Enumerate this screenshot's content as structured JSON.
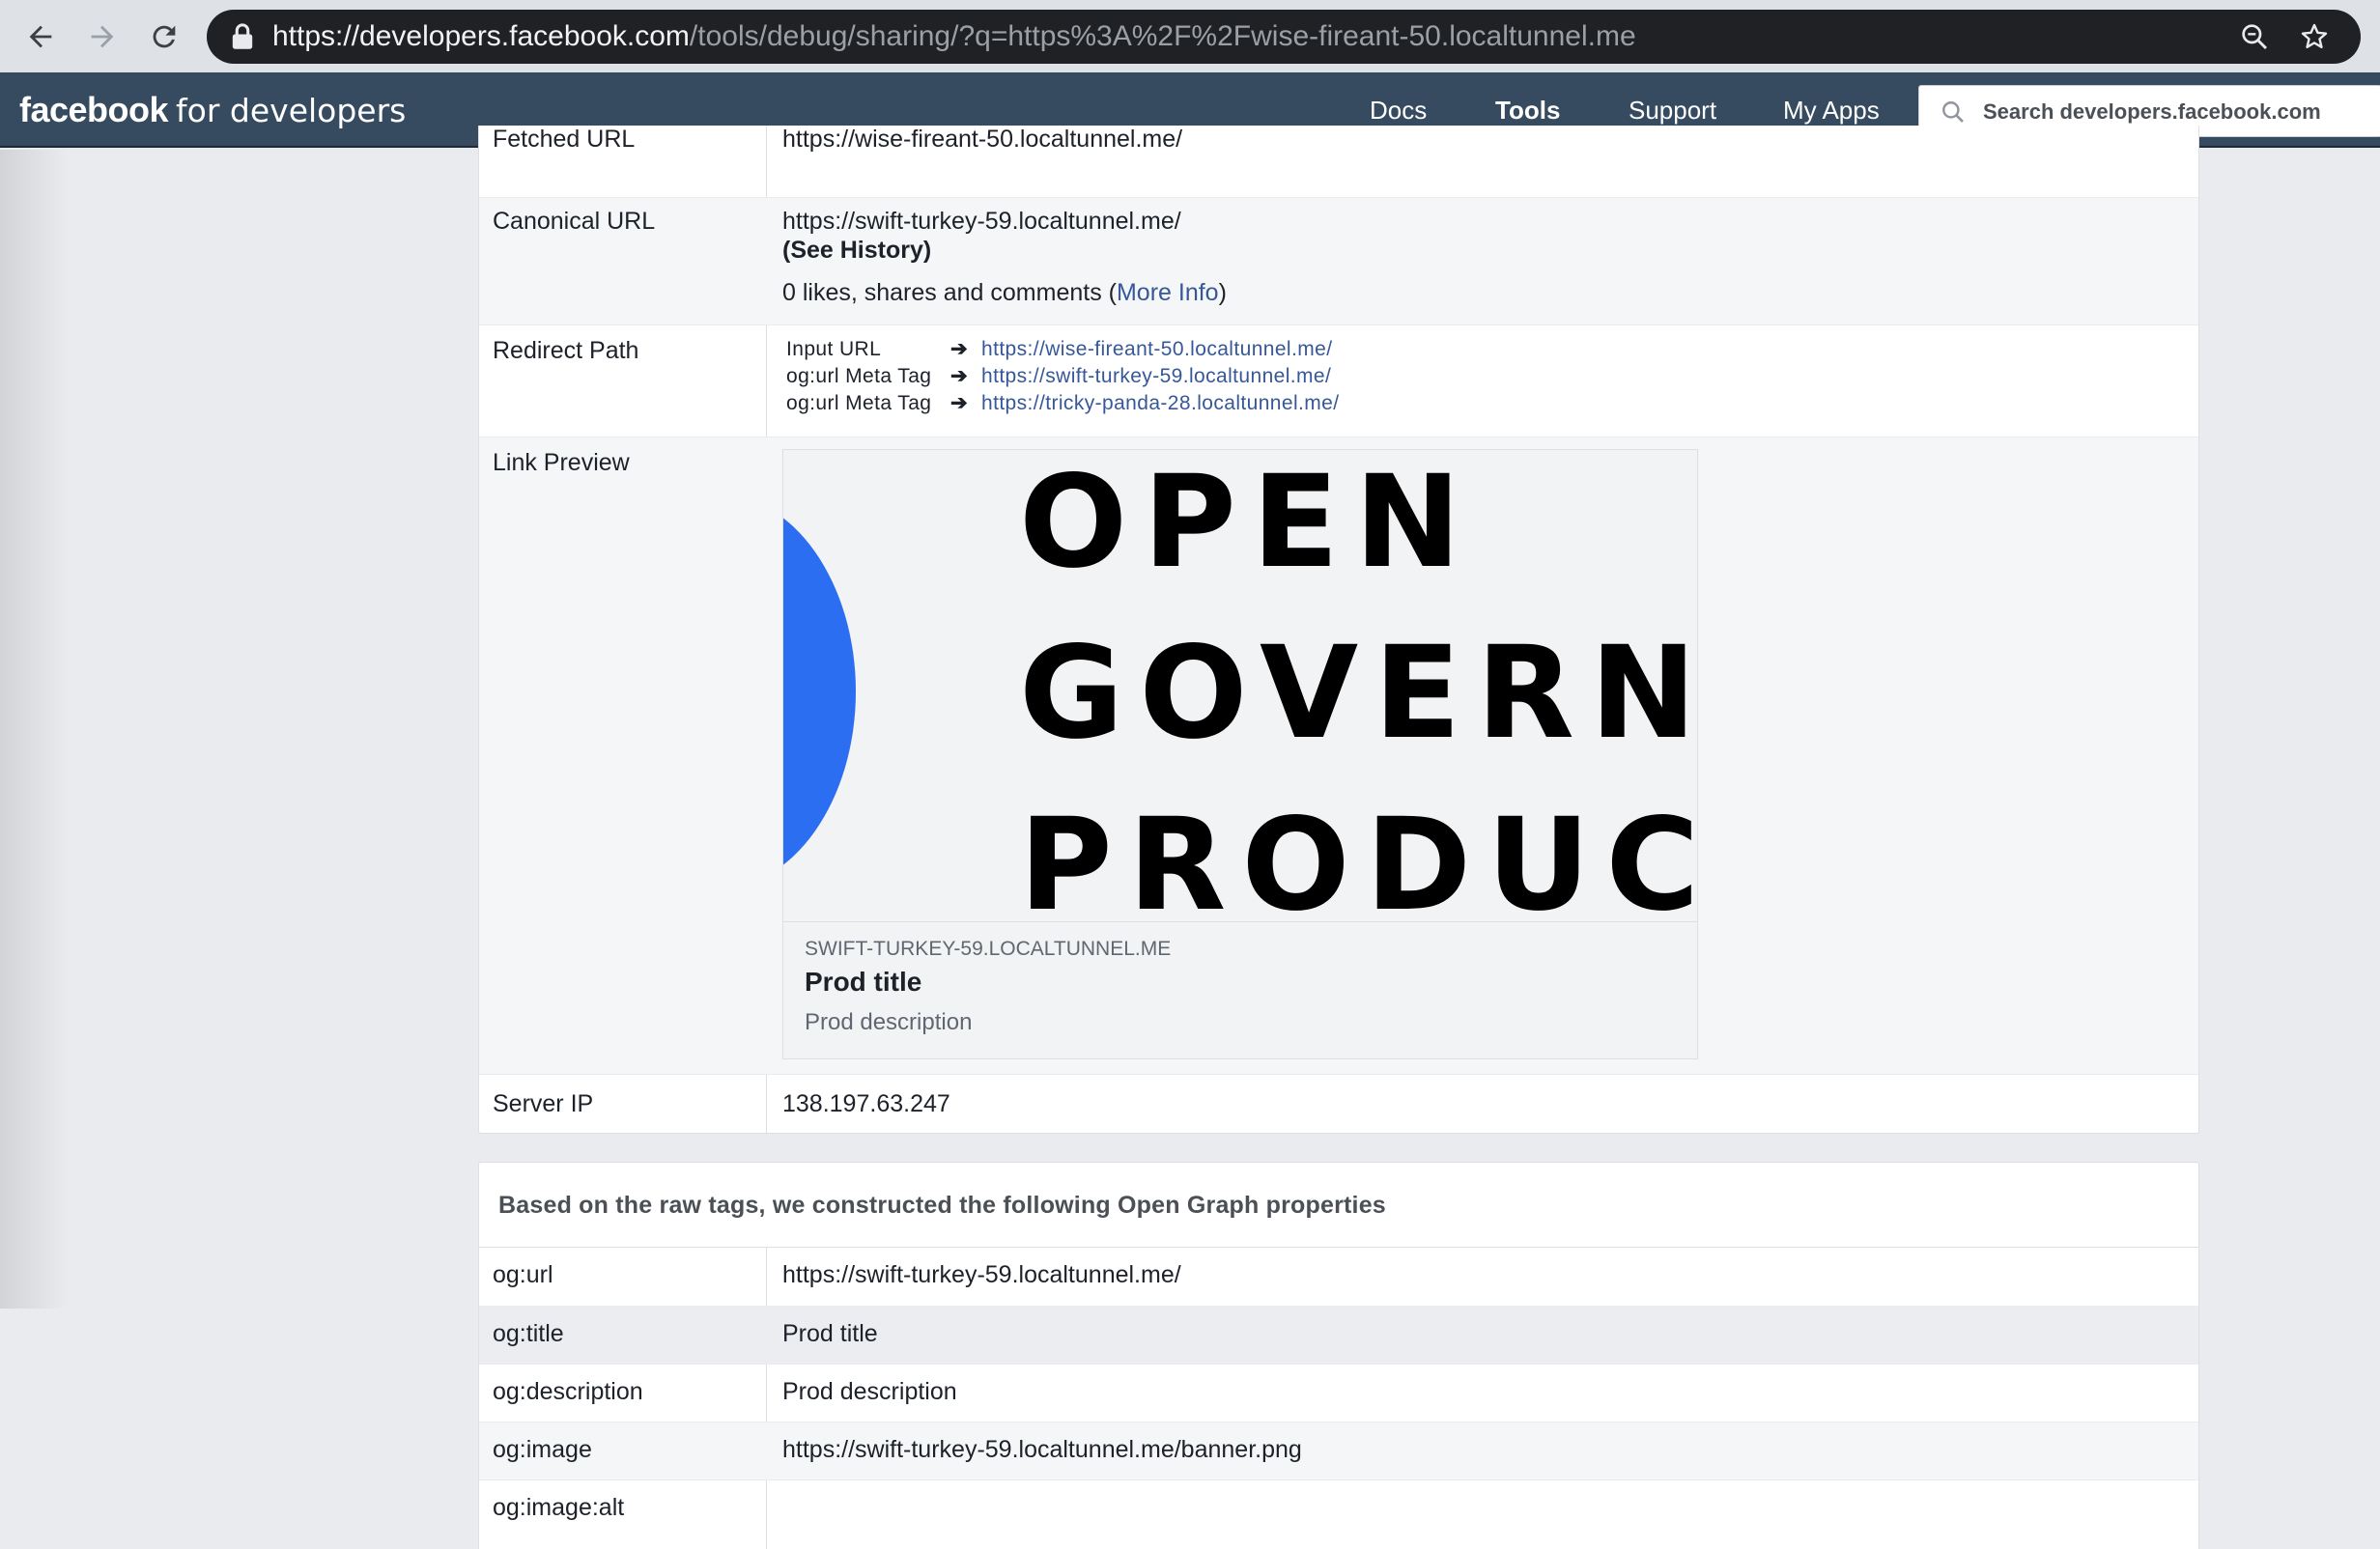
{
  "browser": {
    "url_host": "https://developers.facebook.com",
    "url_path": "/tools/debug/sharing/?q=https%3A%2F%2Fwise-fireant-50.localtunnel.me"
  },
  "header": {
    "logo_brand": "facebook",
    "logo_suffix": "for developers",
    "nav": [
      "Docs",
      "Tools",
      "Support",
      "My Apps"
    ],
    "search_placeholder": "Search developers.facebook.com"
  },
  "details": {
    "fetched_url": {
      "label": "Fetched URL",
      "value": "https://wise-fireant-50.localtunnel.me/"
    },
    "canonical_url": {
      "label": "Canonical URL",
      "value": "https://swift-turkey-59.localtunnel.me/",
      "see_history": "(See History)",
      "engagement_prefix": "0 likes, shares and comments (",
      "more_info": "More Info",
      "engagement_suffix": ")"
    },
    "redirect_path": {
      "label": "Redirect Path",
      "arrow": "➔",
      "steps": [
        {
          "key": "Input URL",
          "url": "https://wise-fireant-50.localtunnel.me/"
        },
        {
          "key": "og:url Meta Tag",
          "url": "https://swift-turkey-59.localtunnel.me/"
        },
        {
          "key": "og:url Meta Tag",
          "url": "https://tricky-panda-28.localtunnel.me/"
        }
      ]
    },
    "link_preview": {
      "label": "Link Preview",
      "image_words": [
        "OPEN",
        "GOVERN",
        "PRODUC"
      ],
      "domain": "SWIFT-TURKEY-59.LOCALTUNNEL.ME",
      "title": "Prod title",
      "description": "Prod description"
    },
    "server_ip": {
      "label": "Server IP",
      "value": "138.197.63.247"
    }
  },
  "og": {
    "heading": "Based on the raw tags, we constructed the following Open Graph properties",
    "rows": [
      {
        "key": "og:url",
        "value": "https://swift-turkey-59.localtunnel.me/"
      },
      {
        "key": "og:title",
        "value": "Prod title"
      },
      {
        "key": "og:description",
        "value": "Prod description"
      },
      {
        "key": "og:image",
        "value": "https://swift-turkey-59.localtunnel.me/banner.png"
      },
      {
        "key": "og:image:alt",
        "value": ""
      }
    ]
  },
  "colors": {
    "link": "#365899",
    "fb_header": "#364b60",
    "preview_accent": "#2c6ef2"
  }
}
